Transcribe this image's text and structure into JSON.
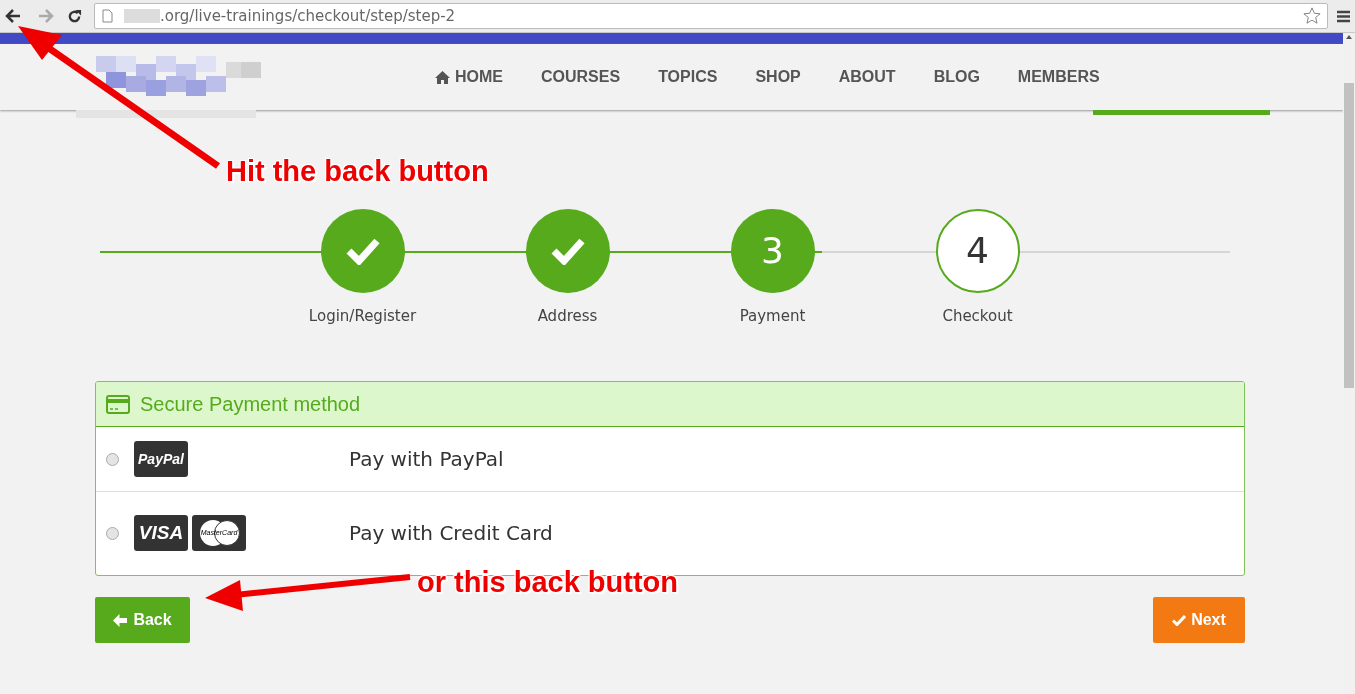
{
  "browser": {
    "url": ".org/live-trainings/checkout/step/step-2"
  },
  "nav": {
    "items": [
      {
        "label": "HOME",
        "kind": "icon"
      },
      {
        "label": "COURSES"
      },
      {
        "label": "TOPICS"
      },
      {
        "label": "SHOP"
      },
      {
        "label": "ABOUT"
      },
      {
        "label": "BLOG"
      },
      {
        "label": "MEMBERS"
      }
    ]
  },
  "steps": [
    {
      "label": "Login/Register",
      "kind": "done"
    },
    {
      "label": "Address",
      "kind": "done"
    },
    {
      "label": "Payment",
      "kind": "current",
      "number": "3"
    },
    {
      "label": "Checkout",
      "kind": "pending",
      "number": "4"
    }
  ],
  "payment": {
    "title": "Secure Payment method",
    "options": [
      {
        "label": "Pay with PayPal",
        "selected": false,
        "cards": [
          "PayPal"
        ]
      },
      {
        "label": "Pay with Credit Card",
        "selected": false,
        "cards": [
          "VISA",
          "MasterCard"
        ]
      }
    ]
  },
  "buttons": {
    "back": "Back",
    "next": "Next"
  },
  "annotations": [
    {
      "text": "Hit the back button"
    },
    {
      "text": "or this back button"
    }
  ]
}
